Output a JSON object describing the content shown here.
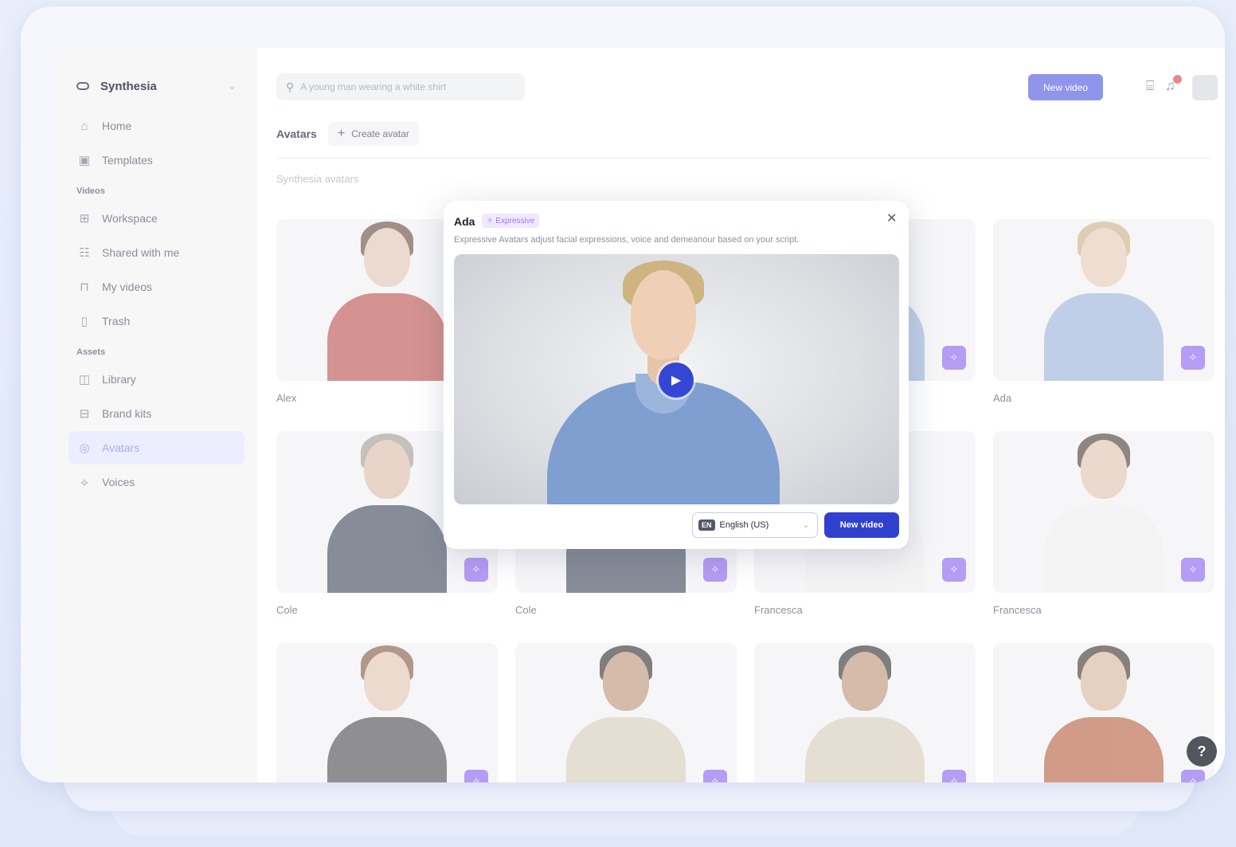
{
  "sidebar": {
    "brand": "Synthesia",
    "items_top": [
      {
        "label": "Home",
        "icon": "home-icon"
      },
      {
        "label": "Templates",
        "icon": "templates-icon"
      }
    ],
    "section_videos": "Videos",
    "items_videos": [
      {
        "label": "Workspace",
        "icon": "grid-icon"
      },
      {
        "label": "Shared with me",
        "icon": "users-icon"
      },
      {
        "label": "My videos",
        "icon": "lock-icon"
      },
      {
        "label": "Trash",
        "icon": "trash-icon"
      }
    ],
    "section_assets": "Assets",
    "items_assets": [
      {
        "label": "Library",
        "icon": "book-icon"
      },
      {
        "label": "Brand kits",
        "icon": "brand-kit-icon"
      },
      {
        "label": "Avatars",
        "icon": "avatar-icon",
        "active": true
      },
      {
        "label": "Voices",
        "icon": "voice-icon"
      }
    ]
  },
  "topbar": {
    "search_placeholder": "A young man wearing a white shirt",
    "new_video": "New video",
    "notification_count": "1"
  },
  "page": {
    "title": "Avatars",
    "create_avatar": "Create avatar",
    "subheading": "Synthesia avatars"
  },
  "avatars": [
    {
      "name": "Alex",
      "hair": "#5b3a28",
      "skin": "#e2c4ae",
      "shirt": "#b8413a"
    },
    {
      "name": "",
      "hair": "#c6ab7a",
      "skin": "#e9c9b1",
      "shirt": "#93afd9"
    },
    {
      "name": "",
      "hair": "#c6ab7a",
      "skin": "#e9c9b1",
      "shirt": "#93afd9"
    },
    {
      "name": "Ada",
      "hair": "#c6ab7a",
      "skin": "#e9c9b1",
      "shirt": "#93afd9"
    },
    {
      "name": "Cole",
      "hair": "#9a948c",
      "skin": "#dcb9a0",
      "shirt": "#2b3448"
    },
    {
      "name": "Cole",
      "hair": "#9a948c",
      "skin": "#dcb9a0",
      "shirt": "#2b3448"
    },
    {
      "name": "Francesca",
      "hair": "#3a2a22",
      "skin": "#e2c2aa",
      "shirt": "#f1f1f1"
    },
    {
      "name": "Francesca",
      "hair": "#3a2a22",
      "skin": "#e2c2aa",
      "shirt": "#f1f1f1"
    },
    {
      "name": "",
      "hair": "#7a4a2e",
      "skin": "#e4c4ac",
      "shirt": "#3b3b3f"
    },
    {
      "name": "",
      "hair": "#1f1a18",
      "skin": "#b98a6a",
      "shirt": "#d8cbb5"
    },
    {
      "name": "",
      "hair": "#1f1a18",
      "skin": "#b98a6a",
      "shirt": "#d8cbb5"
    },
    {
      "name": "",
      "hair": "#2d211b",
      "skin": "#d9b294",
      "shirt": "#b4522e"
    }
  ],
  "modal": {
    "title": "Ada",
    "badge": "Expressive",
    "description": "Expressive Avatars adjust facial expressions, voice and demeanour based on your script.",
    "lang_code": "EN",
    "language": "English (US)",
    "new_video": "New video"
  },
  "help": "?"
}
